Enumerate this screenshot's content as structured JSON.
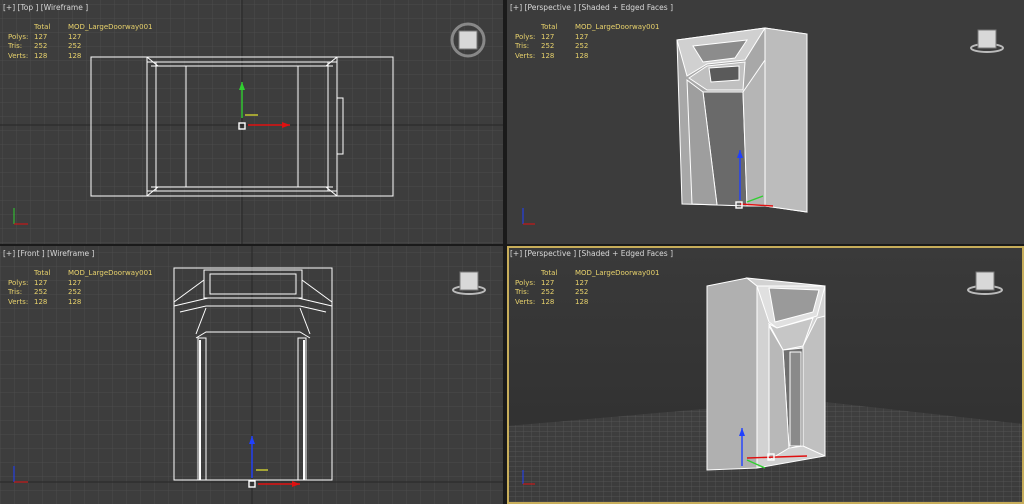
{
  "viewports": [
    {
      "id": "top",
      "label": "[+] [Top ] [Wireframe ]",
      "active": false,
      "stats": {
        "header": {
          "a": "",
          "b": "Total",
          "c": "MOD_LargeDoorway001"
        },
        "rows": [
          {
            "k": "Polys:",
            "total": "127",
            "obj": "127"
          },
          {
            "k": "Tris:",
            "total": "252",
            "obj": "252"
          },
          {
            "k": "Verts:",
            "total": "128",
            "obj": "128"
          }
        ]
      }
    },
    {
      "id": "persp-tr",
      "label": "[+] [Perspective ] [Shaded + Edged Faces ]",
      "active": false,
      "stats": {
        "header": {
          "a": "",
          "b": "Total",
          "c": "MOD_LargeDoorway001"
        },
        "rows": [
          {
            "k": "Polys:",
            "total": "127",
            "obj": "127"
          },
          {
            "k": "Tris:",
            "total": "252",
            "obj": "252"
          },
          {
            "k": "Verts:",
            "total": "128",
            "obj": "128"
          }
        ]
      }
    },
    {
      "id": "front",
      "label": "[+] [Front ] [Wireframe ]",
      "active": false,
      "stats": {
        "header": {
          "a": "",
          "b": "Total",
          "c": "MOD_LargeDoorway001"
        },
        "rows": [
          {
            "k": "Polys:",
            "total": "127",
            "obj": "127"
          },
          {
            "k": "Tris:",
            "total": "252",
            "obj": "252"
          },
          {
            "k": "Verts:",
            "total": "128",
            "obj": "128"
          }
        ]
      }
    },
    {
      "id": "persp-br",
      "label": "[+] [Perspective ] [Shaded + Edged Faces ]",
      "active": true,
      "stats": {
        "header": {
          "a": "",
          "b": "Total",
          "c": "MOD_LargeDoorway001"
        },
        "rows": [
          {
            "k": "Polys:",
            "total": "127",
            "obj": "127"
          },
          {
            "k": "Tris:",
            "total": "252",
            "obj": "252"
          },
          {
            "k": "Verts:",
            "total": "128",
            "obj": "128"
          }
        ]
      }
    }
  ],
  "viewcube_label": "TOP",
  "colors": {
    "viewport_bg": "#3d3d3d",
    "grid": "#4a4a4a",
    "wire": "#ffffff",
    "stats": "#e8d26c",
    "active_border": "#c7ad5a",
    "axis_x": "#e01010",
    "axis_y": "#30d030",
    "axis_z": "#2040ff"
  }
}
